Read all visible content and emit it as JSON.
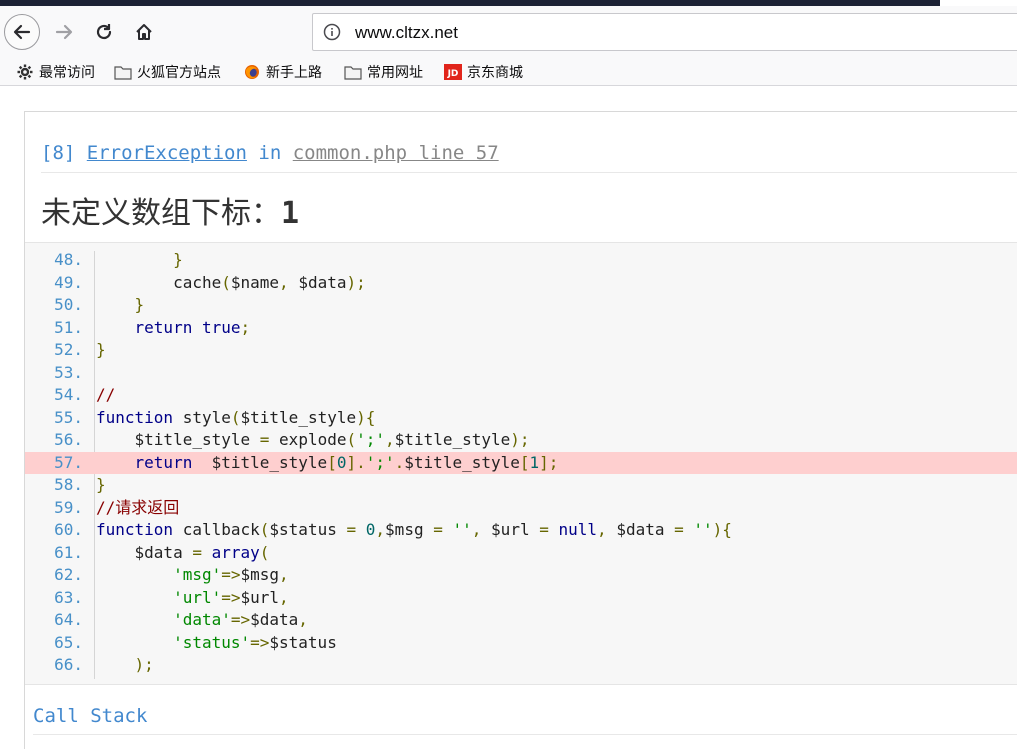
{
  "browser": {
    "url": "www.cltzx.net",
    "bookmarks": [
      {
        "label": "最常访问",
        "icon": "gear-icon"
      },
      {
        "label": "火狐官方站点",
        "icon": "folder-icon"
      },
      {
        "label": "新手上路",
        "icon": "firefox-icon"
      },
      {
        "label": "常用网址",
        "icon": "folder-icon"
      },
      {
        "label": "京东商城",
        "icon": "jd-icon"
      }
    ]
  },
  "error": {
    "code": "[8]",
    "type": "ErrorException",
    "in_word": "in",
    "file_ref": "common.php line 57",
    "message_text": "未定义数组下标：",
    "message_num": "1"
  },
  "code": {
    "highlight_line": "57.",
    "lines": [
      {
        "no": "48.",
        "text": "        }"
      },
      {
        "no": "49.",
        "text": "        cache($name, $data);"
      },
      {
        "no": "50.",
        "text": "    }"
      },
      {
        "no": "51.",
        "text": "    return true;"
      },
      {
        "no": "52.",
        "text": "}"
      },
      {
        "no": "53.",
        "text": ""
      },
      {
        "no": "54.",
        "text": "//"
      },
      {
        "no": "55.",
        "text": "function style($title_style){"
      },
      {
        "no": "56.",
        "text": "    $title_style = explode(';',$title_style);"
      },
      {
        "no": "57.",
        "text": "    return  $title_style[0].';'.$title_style[1];"
      },
      {
        "no": "58.",
        "text": "}"
      },
      {
        "no": "59.",
        "text": "//请求返回"
      },
      {
        "no": "60.",
        "text": "function callback($status = 0,$msg = '', $url = null, $data = ''){"
      },
      {
        "no": "61.",
        "text": "    $data = array("
      },
      {
        "no": "62.",
        "text": "        'msg'=>$msg,"
      },
      {
        "no": "63.",
        "text": "        'url'=>$url,"
      },
      {
        "no": "64.",
        "text": "        'data'=>$data,"
      },
      {
        "no": "65.",
        "text": "        'status'=>$status"
      },
      {
        "no": "66.",
        "text": "    );"
      }
    ]
  },
  "call_stack_label": "Call Stack"
}
